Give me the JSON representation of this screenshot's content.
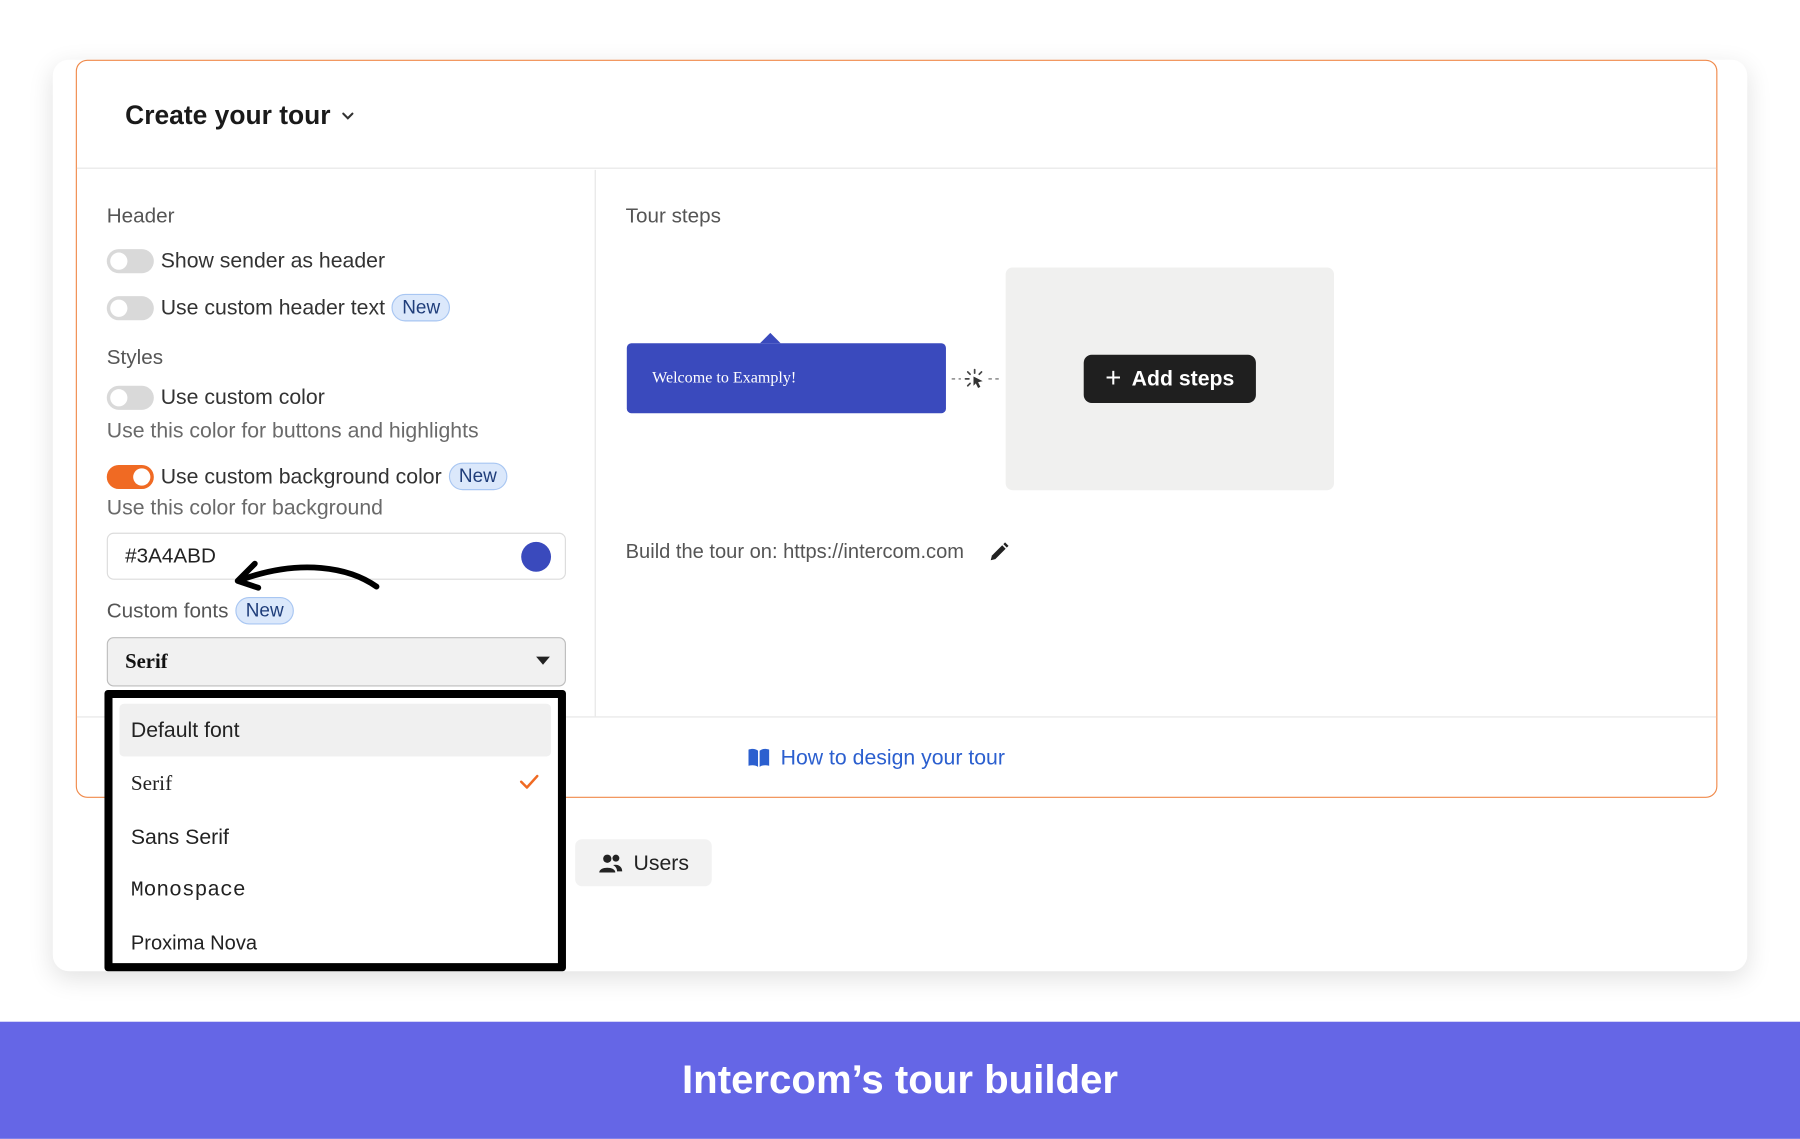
{
  "panel": {
    "title": "Create your tour"
  },
  "left": {
    "header_section": "Header",
    "show_sender": "Show sender as header",
    "custom_header_text": "Use custom header text",
    "badge_new": "New",
    "styles_section": "Styles",
    "custom_color": "Use custom color",
    "custom_color_help": "Use this color for buttons and highlights",
    "custom_bg_color": "Use custom background color",
    "custom_bg_help": "Use this color for background",
    "color_value": "#3A4ABD",
    "custom_fonts": "Custom fonts",
    "font_selected": "Serif"
  },
  "toggles": {
    "show_sender": false,
    "custom_header_text": false,
    "custom_color": false,
    "custom_bg_color": true
  },
  "right": {
    "tour_steps": "Tour steps",
    "step_preview": "Welcome to Examply!",
    "add_steps": "Add steps",
    "build_on": "Build the tour on: https://intercom.com"
  },
  "footer": {
    "how_to_link": "How to design your tour"
  },
  "users_button": "Users",
  "dropdown": {
    "options": [
      "Default font",
      "Serif",
      "Sans Serif",
      "Monospace",
      "Proxima Nova"
    ],
    "selected": "Serif"
  },
  "caption": "Intercom’s tour builder",
  "colors": {
    "accent_orange": "#f06a23",
    "step_blue": "#3a4abd",
    "link_blue": "#2b5fcf",
    "caption_band": "#6566e6"
  }
}
